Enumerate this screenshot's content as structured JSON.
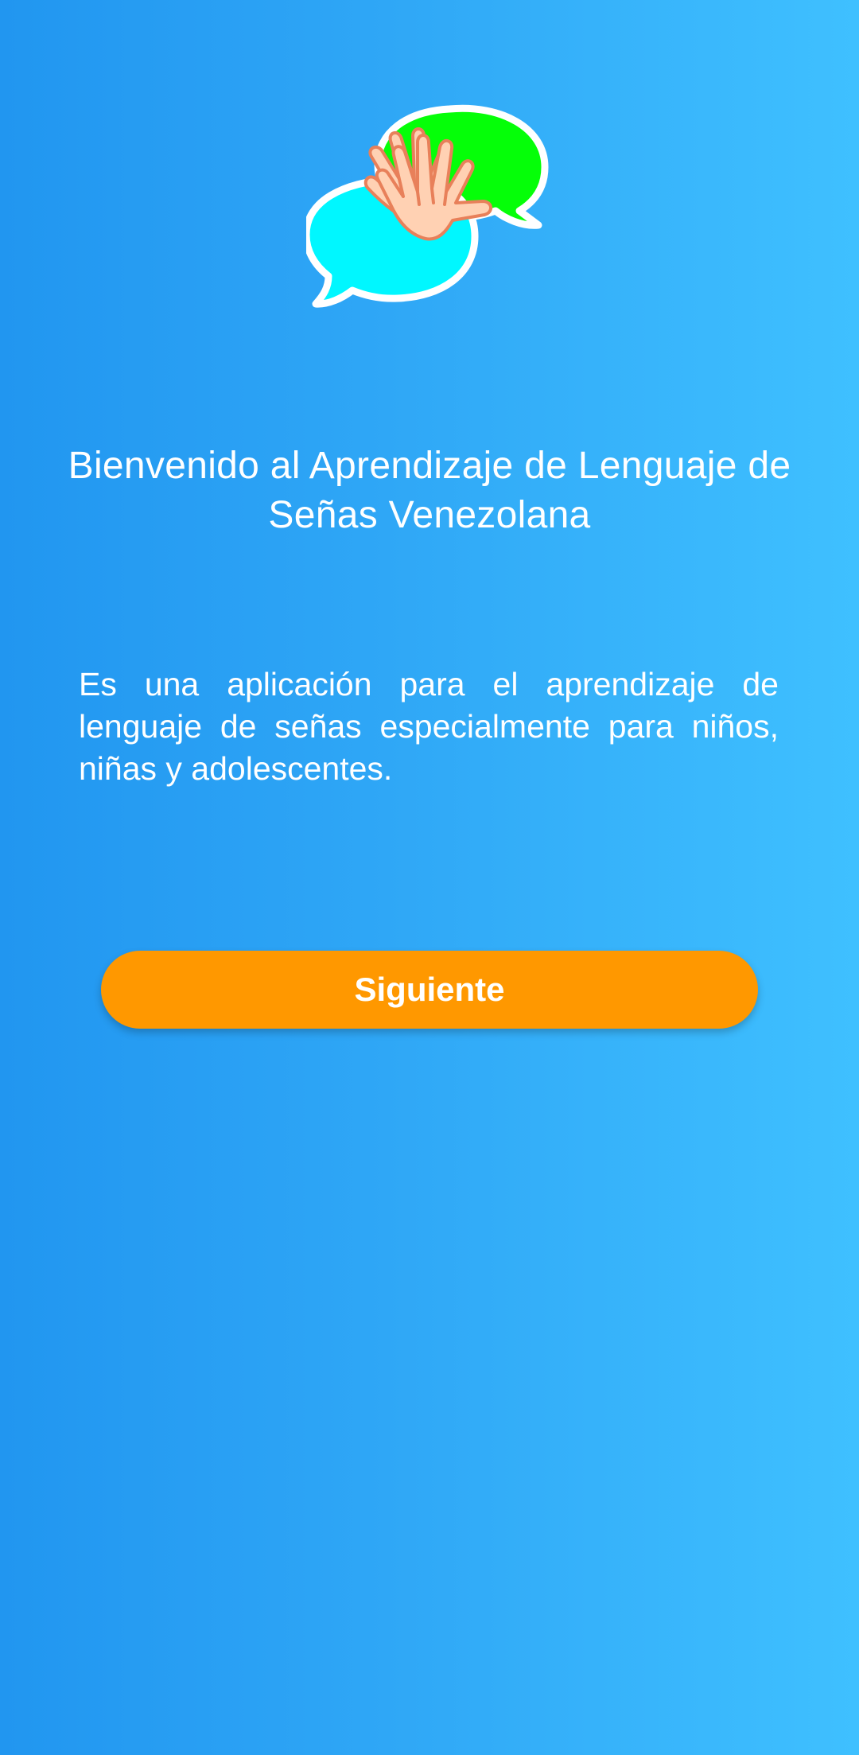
{
  "app": {
    "logo": {
      "icon": "sign-language-chat-logo",
      "colors": {
        "bubble_left": "#00f7ff",
        "bubble_right": "#05ff08",
        "outline": "#ffffff",
        "hand_fill": "#ffd1b3",
        "hand_stroke": "#e8805a"
      }
    },
    "welcome_title": "Bienvenido al Aprendizaje de Lenguaje de Señas Venezolana",
    "description": "Es una aplicación para el aprendizaje de lenguaje de señas especialmente para niños, niñas y adolescentes.",
    "next_button": {
      "label": "Siguiente",
      "color": "#ff9800"
    }
  },
  "theme": {
    "background_start": "#2196f0",
    "background_end": "#3fc0ff",
    "text_color": "#ffffff"
  }
}
